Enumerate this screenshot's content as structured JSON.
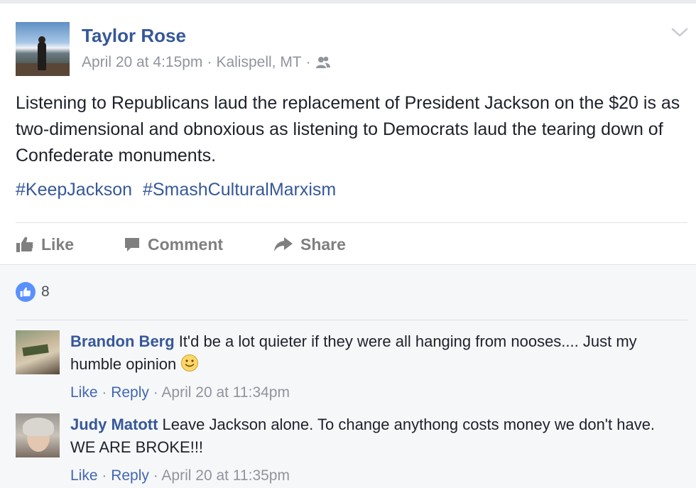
{
  "post": {
    "author": "Taylor Rose",
    "timestamp": "April 20 at 4:15pm",
    "location": "Kalispell, MT",
    "separator": "·",
    "audience_icon": "friends-icon",
    "text": "Listening to Republicans laud the replacement of President Jackson on the $20 is as two-dimensional and obnoxious as listening to Democrats laud the tearing down of Confederate monuments.",
    "hashtags": [
      "#KeepJackson",
      "#SmashCulturalMarxism"
    ]
  },
  "actions": {
    "like_label": "Like",
    "comment_label": "Comment",
    "share_label": "Share"
  },
  "reactions": {
    "like_count": "8"
  },
  "comments": [
    {
      "author": "Brandon Berg",
      "text": "It'd be a lot quieter if they were all hanging from nooses.... Just my humble opinion",
      "has_emoji": true,
      "like_label": "Like",
      "reply_label": "Reply",
      "timestamp": "April 20 at 11:34pm"
    },
    {
      "author": "Judy Matott",
      "text": "Leave Jackson alone. To change anythong costs money we don't have. WE ARE BROKE!!!",
      "has_emoji": false,
      "like_label": "Like",
      "reply_label": "Reply",
      "timestamp": "April 20 at 11:35pm"
    }
  ],
  "colors": {
    "link_blue": "#365899",
    "meta_gray": "#90949c",
    "like_blue": "#5890ff",
    "action_gray": "#7f7f7f"
  }
}
